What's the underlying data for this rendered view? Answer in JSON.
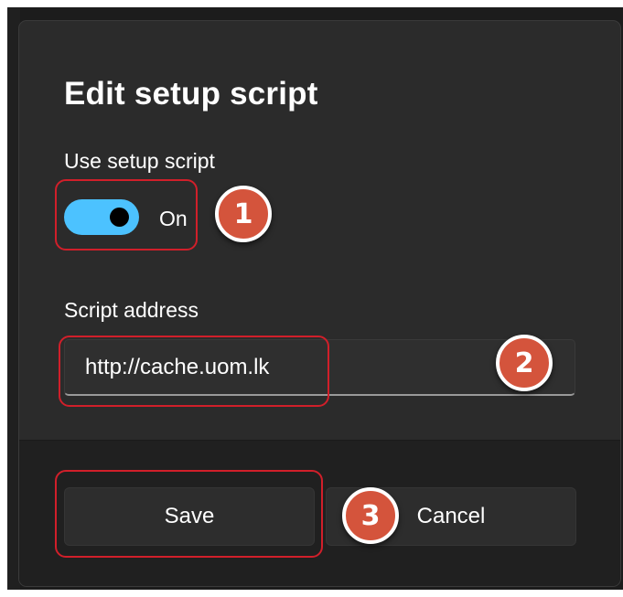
{
  "dialog": {
    "title": "Edit setup script",
    "use_script_label": "Use setup script",
    "toggle": {
      "state_label": "On",
      "on": true
    },
    "address_label": "Script address",
    "address_value": "http://cache.uom.lk",
    "save_label": "Save",
    "cancel_label": "Cancel"
  },
  "annotations": {
    "markers": [
      "1",
      "2",
      "3"
    ],
    "marker_color": "#d4543c",
    "highlight_color": "#d11f2a"
  },
  "colors": {
    "accent": "#4cc2ff",
    "dialog_bg": "#2b2b2b",
    "footer_bg": "#202020"
  }
}
